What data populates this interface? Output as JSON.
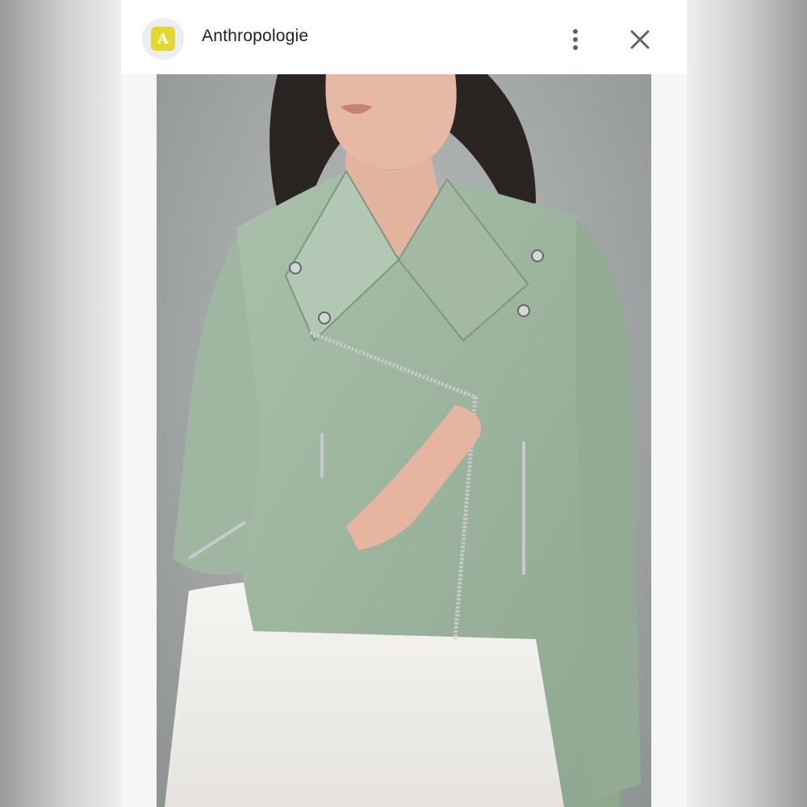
{
  "app": {
    "name": "Anthropologie",
    "avatar_letter": "A",
    "avatar_color": "#e2d830"
  },
  "header": {
    "more_icon": "more-vertical-icon",
    "close_icon": "close-icon"
  },
  "image": {
    "subject": "product-photo",
    "jacket_color": "#9db59f",
    "skirt_color": "#f2f0ed"
  }
}
